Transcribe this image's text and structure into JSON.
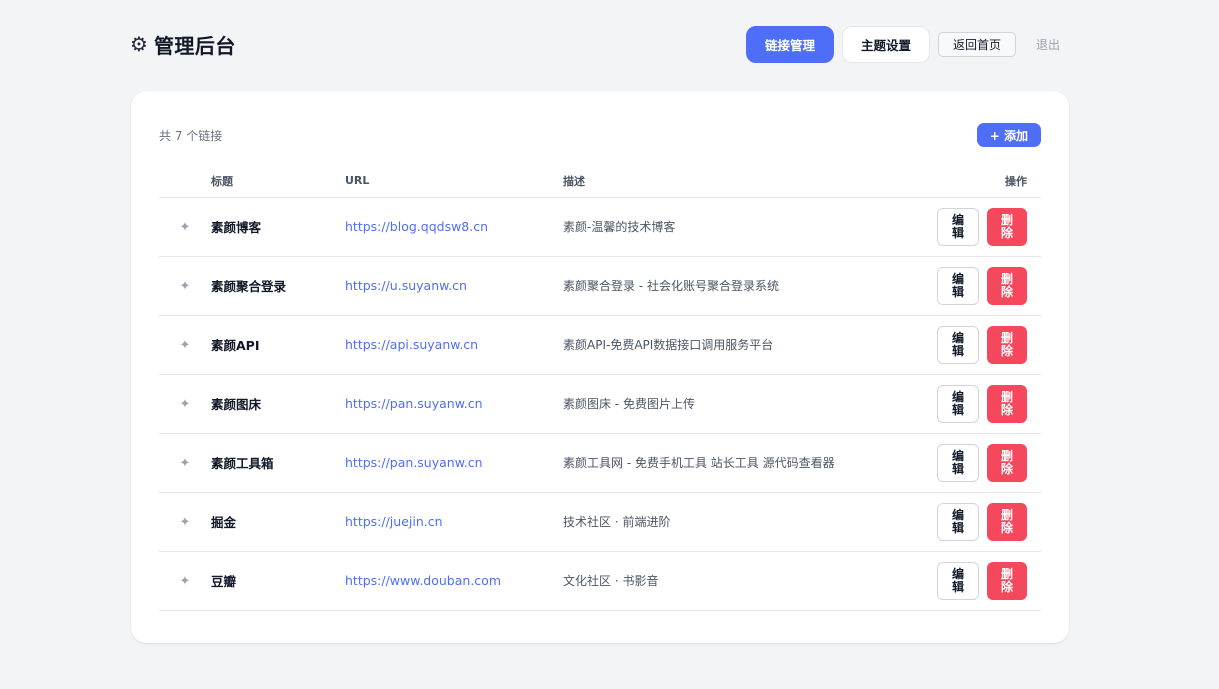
{
  "header": {
    "gear_icon": "⚙",
    "title": "管理后台",
    "nav": {
      "links_label": "链接管理",
      "theme_label": "主题设置",
      "home_label": "返回首页",
      "logout_label": "退出"
    }
  },
  "links": {
    "count_text": "共 7 个链接",
    "add_label": "+ 添加",
    "columns": [
      "",
      "标题",
      "URL",
      "描述",
      "操作"
    ],
    "handle_icon": "✦",
    "edit_label": "编辑",
    "delete_label": "删除",
    "rows": [
      {
        "title": "素颜博客",
        "url": "https://blog.qqdsw8.cn",
        "desc": "素颜-温馨的技术博客"
      },
      {
        "title": "素颜聚合登录",
        "url": "https://u.suyanw.cn",
        "desc": "素颜聚合登录 - 社会化账号聚合登录系统"
      },
      {
        "title": "素颜API",
        "url": "https://api.suyanw.cn",
        "desc": "素颜API-免费API数据接口调用服务平台"
      },
      {
        "title": "素颜图床",
        "url": "https://pan.suyanw.cn",
        "desc": "素颜图床 - 免费图片上传"
      },
      {
        "title": "素颜工具箱",
        "url": "https://pan.suyanw.cn",
        "desc": "素颜工具网 - 免费手机工具 站长工具 源代码查看器"
      },
      {
        "title": "掘金",
        "url": "https://juejin.cn",
        "desc": "技术社区 · 前端进阶"
      },
      {
        "title": "豆瓣",
        "url": "https://www.douban.com",
        "desc": "文化社区 · 书影音"
      }
    ]
  },
  "colors": {
    "accent": "#4f6ef7",
    "danger": "#f5485d",
    "background": "#f3f4f6"
  }
}
